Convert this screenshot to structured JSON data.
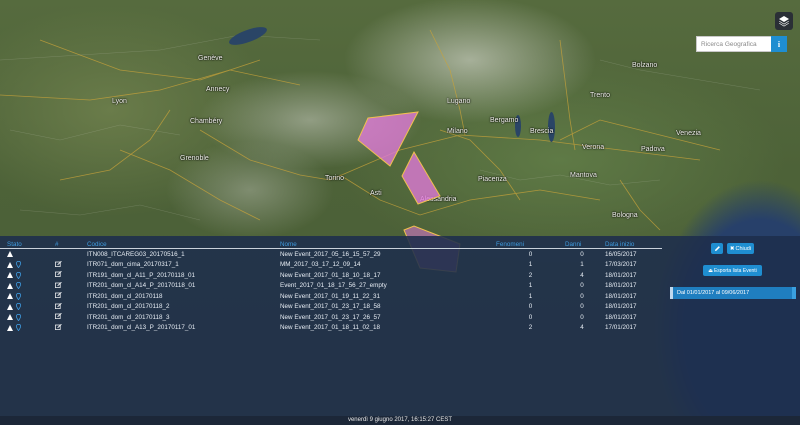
{
  "map": {
    "cities": [
      {
        "name": "Milano"
      },
      {
        "name": "Torino"
      },
      {
        "name": "Venezia"
      },
      {
        "name": "Verona"
      },
      {
        "name": "Padova"
      },
      {
        "name": "Bergamo"
      },
      {
        "name": "Brescia"
      },
      {
        "name": "Genève"
      },
      {
        "name": "Lyon"
      },
      {
        "name": "Grenoble"
      },
      {
        "name": "Trento"
      },
      {
        "name": "Piacenza"
      },
      {
        "name": "Asti"
      },
      {
        "name": "Alessandria"
      },
      {
        "name": "Chambéry"
      },
      {
        "name": "Annecy"
      },
      {
        "name": "Bologna"
      },
      {
        "name": "Mantova"
      },
      {
        "name": "Lugano"
      },
      {
        "name": "Bolzano"
      }
    ],
    "overlay_color": "#e07ad8"
  },
  "search": {
    "placeholder": "Ricerca Geografica",
    "info_label": "i"
  },
  "table": {
    "headers": {
      "stato": "Stato",
      "hash": "#",
      "codice": "Codice",
      "nome": "Nome",
      "fenomeni": "Fenomeni",
      "danni": "Danni",
      "data_inizio": "Data inizio"
    },
    "rows": [
      {
        "codice": "ITN008_ITCAREG03_20170516_1",
        "nome": "New Event_2017_05_16_15_57_29",
        "fenomeni": "0",
        "danni": "0",
        "data": "16/05/2017",
        "has_pin": false,
        "has_edit": false
      },
      {
        "codice": "ITR071_dom_cima_20170317_1",
        "nome": "MM_2017_03_17_12_09_14",
        "fenomeni": "1",
        "danni": "1",
        "data": "17/03/2017",
        "has_pin": true,
        "has_edit": true
      },
      {
        "codice": "ITR191_dom_cl_A11_P_20170118_01",
        "nome": "New Event_2017_01_18_10_18_17",
        "fenomeni": "2",
        "danni": "4",
        "data": "18/01/2017",
        "has_pin": true,
        "has_edit": true
      },
      {
        "codice": "ITR201_dom_cl_A14_P_20170118_01",
        "nome": "Event_2017_01_18_17_56_27_empty",
        "fenomeni": "1",
        "danni": "0",
        "data": "18/01/2017",
        "has_pin": true,
        "has_edit": true
      },
      {
        "codice": "ITR201_dom_cl_20170118",
        "nome": "New Event_2017_01_19_11_22_31",
        "fenomeni": "1",
        "danni": "0",
        "data": "18/01/2017",
        "has_pin": true,
        "has_edit": true
      },
      {
        "codice": "ITR201_dom_cl_20170118_2",
        "nome": "New Event_2017_01_23_17_18_58",
        "fenomeni": "0",
        "danni": "0",
        "data": "18/01/2017",
        "has_pin": true,
        "has_edit": true
      },
      {
        "codice": "ITR201_dom_cl_20170118_3",
        "nome": "New Event_2017_01_23_17_26_57",
        "fenomeni": "0",
        "danni": "0",
        "data": "18/01/2017",
        "has_pin": true,
        "has_edit": true
      },
      {
        "codice": "ITR201_dom_cl_A13_P_20170117_01",
        "nome": "New Event_2017_01_18_11_02_18",
        "fenomeni": "2",
        "danni": "4",
        "data": "17/01/2017",
        "has_pin": true,
        "has_edit": true
      }
    ]
  },
  "controls": {
    "close_label": "Chiudi",
    "export_label": "Esporta lista Eventi",
    "date_range": "Dal 01/01/2017 al 09/06/2017"
  },
  "status_bar": {
    "text": "venerdì 9 giugno 2017, 16:15:27 CEST"
  },
  "colors": {
    "accent": "#1f8ed1",
    "header_text": "#3e9be0",
    "panel": "#1e2e4c"
  }
}
